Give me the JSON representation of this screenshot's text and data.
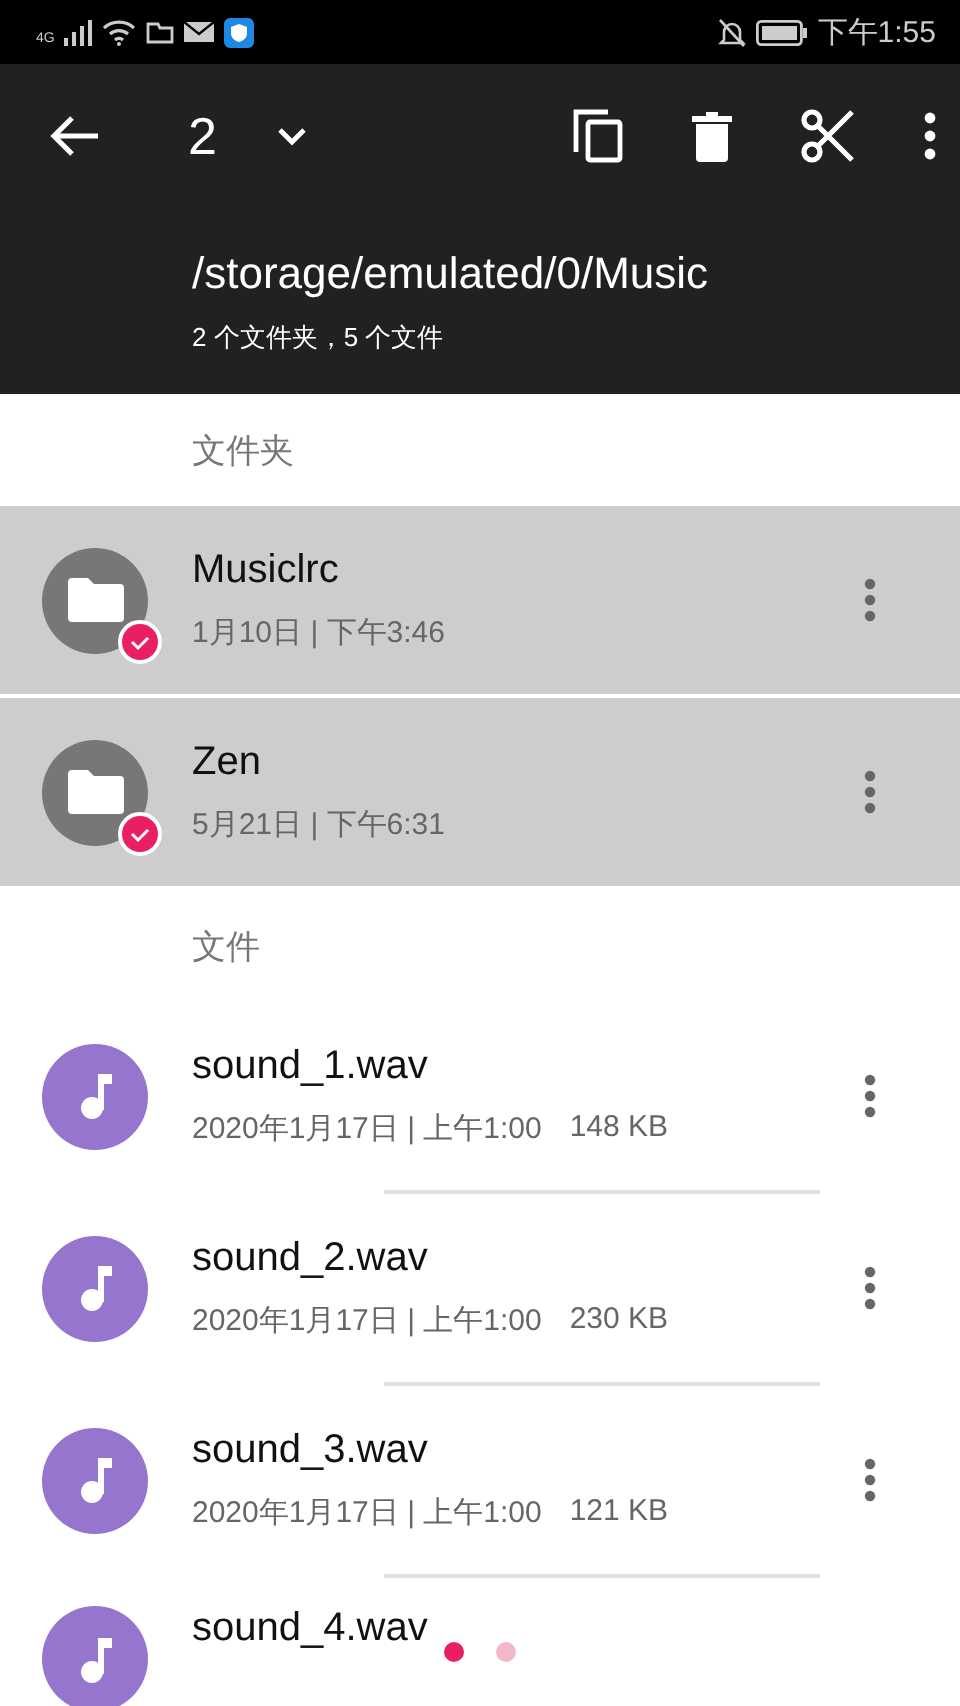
{
  "status_bar": {
    "network": "4G",
    "time": "下午1:55"
  },
  "toolbar": {
    "selected_count": "2"
  },
  "path": {
    "title": "/storage/emulated/0/Music",
    "summary": "2 个文件夹，5 个文件"
  },
  "sections": [
    {
      "header": "文件夹",
      "items": [
        {
          "kind": "folder",
          "name": "Musiclrc",
          "meta": "1月10日 | 下午3:46",
          "selected": true
        },
        {
          "kind": "folder",
          "name": "Zen",
          "meta": "5月21日 | 下午6:31",
          "selected": true
        }
      ]
    },
    {
      "header": "文件",
      "items": [
        {
          "kind": "audio",
          "name": "sound_1.wav",
          "meta": "2020年1月17日 | 上午1:00",
          "size": "148 KB",
          "selected": false
        },
        {
          "kind": "audio",
          "name": "sound_2.wav",
          "meta": "2020年1月17日 | 上午1:00",
          "size": "230 KB",
          "selected": false
        },
        {
          "kind": "audio",
          "name": "sound_3.wav",
          "meta": "2020年1月17日 | 上午1:00",
          "size": "121 KB",
          "selected": false
        },
        {
          "kind": "audio",
          "name": "sound_4.wav",
          "selected": false
        }
      ]
    }
  ],
  "pager": [
    {
      "selected": true
    },
    {
      "selected": false
    }
  ]
}
